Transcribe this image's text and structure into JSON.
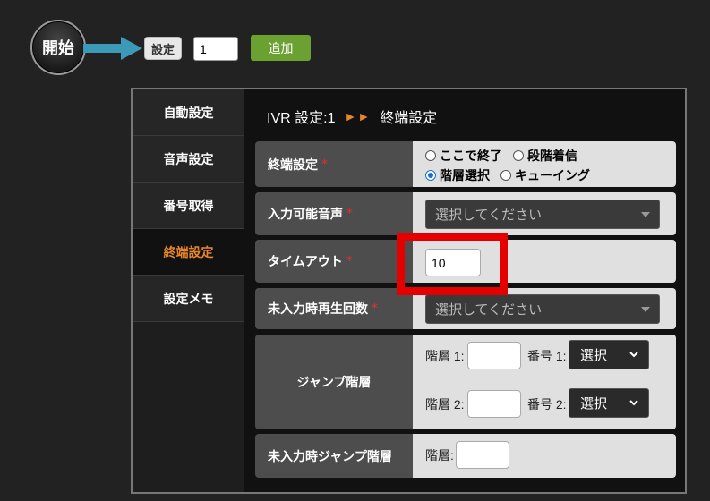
{
  "flow": {
    "start_label": "開始",
    "setting_button": "設定",
    "count_value": "1",
    "add_button": "追加"
  },
  "sidebar": {
    "items": [
      {
        "label": "自動設定"
      },
      {
        "label": "音声設定"
      },
      {
        "label": "番号取得"
      },
      {
        "label": "終端設定"
      },
      {
        "label": "設定メモ"
      }
    ],
    "active_index": 3
  },
  "breadcrumb": {
    "parent": "IVR 設定:1",
    "separator": "►►",
    "current": "終端設定"
  },
  "form": {
    "termination": {
      "label": "終端設定",
      "required": "*",
      "options": [
        "ここで終了",
        "段階着信",
        "階層選択",
        "キューイング"
      ],
      "selected": "階層選択"
    },
    "input_audio": {
      "label": "入力可能音声",
      "required": "*",
      "placeholder": "選択してください"
    },
    "timeout": {
      "label": "タイムアウト",
      "required": "*",
      "value": "10"
    },
    "no_input_replay": {
      "label": "未入力時再生回数",
      "required": "*",
      "placeholder": "選択してください"
    },
    "jump": {
      "label": "ジャンプ階層",
      "level1_label": "階層 1:",
      "number1_label": "番号 1:",
      "select1": "選択",
      "level2_label": "階層 2:",
      "number2_label": "番号 2:",
      "select2": "選択"
    },
    "no_input_jump": {
      "label": "未入力時ジャンプ階層",
      "level_label": "階層:"
    }
  },
  "colors": {
    "accent_orange": "#e8862a",
    "add_green": "#6aa131",
    "arrow_teal": "#3b9ab8",
    "highlight_red": "#e50000"
  }
}
